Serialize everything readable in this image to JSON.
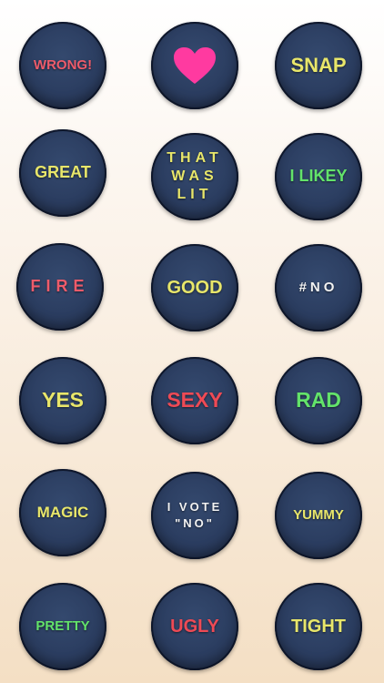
{
  "stickers": [
    {
      "label": "WRONG!",
      "color": "#ee5b6a"
    },
    {
      "label": "",
      "icon": "heart-icon",
      "color": "#ff3aa0"
    },
    {
      "label": "SNAP",
      "color": "#e8e66a"
    },
    {
      "label": "GREAT",
      "color": "#e8e66a"
    },
    {
      "label": "THAT\nWAS\nLIT",
      "color": "#e8e66a"
    },
    {
      "label": "I LIKEY",
      "color": "#63e36a"
    },
    {
      "label": "FIRE",
      "color": "#ee5b6a"
    },
    {
      "label": "GOOD",
      "color": "#e8e66a"
    },
    {
      "label": "#NO",
      "color": "#f2f2f2"
    },
    {
      "label": "YES",
      "color": "#e8e66a"
    },
    {
      "label": "SEXY",
      "color": "#ee4a55"
    },
    {
      "label": "RAD",
      "color": "#63e36a"
    },
    {
      "label": "MAGIC",
      "color": "#e8e66a"
    },
    {
      "label": "I VOTE\n\"NO\"",
      "color": "#f2f2f2"
    },
    {
      "label": "YUMMY",
      "color": "#e8e66a"
    },
    {
      "label": "PRETTY",
      "color": "#63e36a"
    },
    {
      "label": "UGLY",
      "color": "#ee4a55"
    },
    {
      "label": "TIGHT",
      "color": "#e8e66a"
    }
  ]
}
